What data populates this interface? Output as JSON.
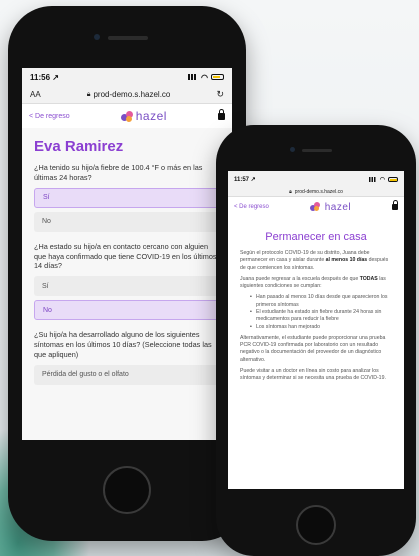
{
  "phone1": {
    "status": {
      "time": "11:56 ↗"
    },
    "url_bar": {
      "text_size": "AA",
      "url": "prod-demo.s.hazel.co"
    },
    "nav": {
      "back_label": "< De regreso",
      "brand": "hazel"
    },
    "student_name": "Eva Ramirez",
    "questions": [
      {
        "text": "¿Ha tenido su hijo/a fiebre de 100.4 °F o más en las últimas 24 horas?",
        "options": [
          {
            "label": "Sí",
            "selected": true
          },
          {
            "label": "No",
            "selected": false
          }
        ]
      },
      {
        "text": "¿Ha estado su hijo/a en contacto cercano con alguien que haya confirmado que tiene COVID-19 en los últimos 14 días?",
        "options": [
          {
            "label": "Sí",
            "selected": false
          },
          {
            "label": "No",
            "selected": true
          }
        ]
      },
      {
        "text": "¿Su hijo/a ha desarrollado alguno de los siguientes síntomas en los últimos 10 días? (Seleccione todas las que apliquen)",
        "options": [
          {
            "label": "Pérdida del gusto o el olfato",
            "selected": false
          }
        ]
      }
    ]
  },
  "phone2": {
    "status": {
      "time": "11:57 ↗"
    },
    "url_bar": {
      "url": "prod-demo.s.hazel.co"
    },
    "nav": {
      "back_label": "< De regreso",
      "brand": "hazel"
    },
    "title": "Permanecer en casa",
    "p1_a": "Según el protocolo COVID-19 de su distrito, Juana debe permanecer en casa y aislar durante ",
    "p1_bold": "al menos 10 días",
    "p1_b": " después de que comiencen los síntomas.",
    "p2_a": "Juana puede regresar a la escuela después de que ",
    "p2_bold": "TODAS",
    "p2_b": " las siguientes condiciones se cumplan:",
    "bullets": [
      "Han pasado al menos 10 días desde que aparecieron los primeros síntomas",
      "El estudiante ha estado sin fiebre durante 24 horas sin medicamentos para reducir la fiebre",
      "Los síntomas han mejorado"
    ],
    "p3": "Alternativamente, el estudiante puede proporcionar una prueba PCR COVID-19 confirmada por laboratorio con un resultado negativo o la documentación del proveedor de un diagnóstico alternativo.",
    "p4": "Puede visitar a un doctor en línea sin costo para analizar los síntomas y determinar si se necesita una prueba de COVID-19."
  },
  "colors": {
    "accent": "#8b3fd1",
    "selected_bg": "#e9dcf8",
    "logo_purple": "#7a4fc4",
    "logo_pink": "#e45a9c"
  },
  "icons": [
    "signal-icon",
    "wifi-icon",
    "battery-icon",
    "lock-icon",
    "reload-icon",
    "padlock-icon",
    "hazel-logo-icon"
  ]
}
